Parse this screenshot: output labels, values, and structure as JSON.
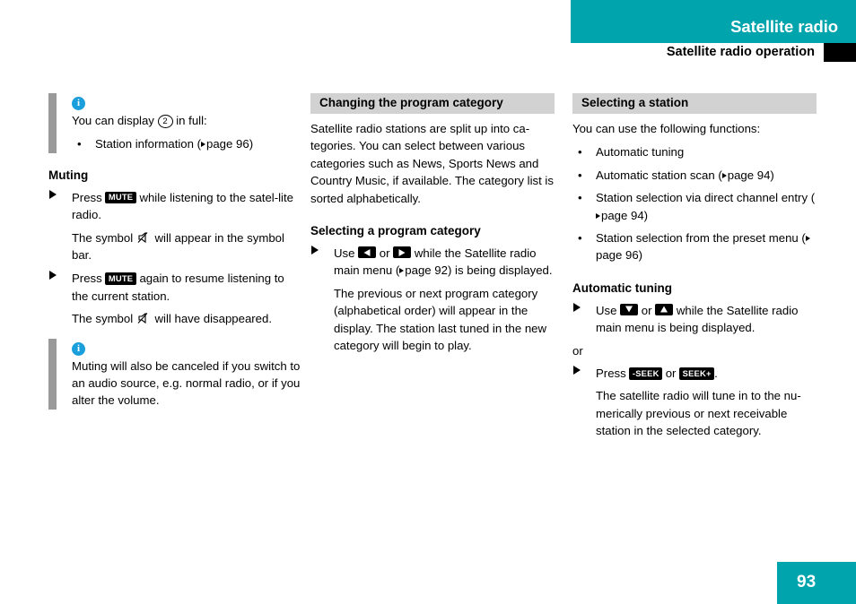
{
  "header": {
    "chapter_title": "Satellite radio",
    "section_title": "Satellite radio operation",
    "teal_color": "#00a4ac"
  },
  "left_column": {
    "note_1": {
      "icon": "info-icon",
      "intro": "You can display",
      "ref_number": "2",
      "intro_tail": "in full:",
      "bullets": [
        {
          "text": "Station information (",
          "page_label": "page 96",
          "tail": ")"
        }
      ]
    },
    "heading_muting": "Muting",
    "step_1": {
      "pre": "Press",
      "key": "MUTE",
      "post": "while listening to the satel-lite radio."
    },
    "para_1": "The symbol ⌗ will appear in the symbol bar.",
    "para_1_pre": "The symbol",
    "para_1_post": "will appear in the symbol bar.",
    "step_2": {
      "pre": "Press",
      "key": "MUTE",
      "post": "again to resume listening to the current station."
    },
    "para_2_pre": "The symbol",
    "para_2_post": "will have disappeared.",
    "note_2": {
      "icon": "info-icon",
      "text": "Muting will also be canceled if you switch to an audio source, e.g. normal radio, or if you alter the volume."
    }
  },
  "middle_column": {
    "section_header": "Changing the program category",
    "paragraph": "Satellite radio stations are split up into ca-tegories. You can select between various categories such as News, Sports News and Country Music, if available. The category list is sorted alphabetically.",
    "sub_heading": "Selecting a program category",
    "step": {
      "use": "Use",
      "key_left": "left-arrow-key",
      "or": "or",
      "key_right": "right-arrow-key",
      "tail_pre": "while the Satellite radio main menu (",
      "page_label": "page 92",
      "tail_post": ") is being displayed."
    },
    "result": "The previous or next program category (alphabetical order) will appear in the display. The station last tuned in the new category will begin to play."
  },
  "right_column": {
    "section_header": "Selecting a station",
    "intro": "You can use the following functions:",
    "bullets": [
      {
        "text": "Automatic tuning",
        "page_label": "",
        "tail": ""
      },
      {
        "text": "Automatic station scan (",
        "page_label": "page 94",
        "tail": ")"
      },
      {
        "text": "Station selection via direct channel entry (",
        "page_label": "page 94",
        "tail": ")"
      },
      {
        "text": "Station selection from the preset menu (",
        "page_label": "page 96",
        "tail": ")"
      }
    ],
    "sub_heading": "Automatic tuning",
    "step_1": {
      "use": "Use",
      "key_down": "down-arrow-key",
      "or": "or",
      "key_up": "up-arrow-key",
      "tail": "while the Satellite radio main menu is being displayed."
    },
    "or_label": "or",
    "step_2": {
      "pre": "Press",
      "key_seek_minus": "-SEEK",
      "or": "or",
      "key_seek_plus": "SEEK+",
      "period": "."
    },
    "result": "The satellite radio will tune in to the nu-merically previous or next receivable station in the selected category."
  },
  "footer": {
    "page_number": "93"
  }
}
